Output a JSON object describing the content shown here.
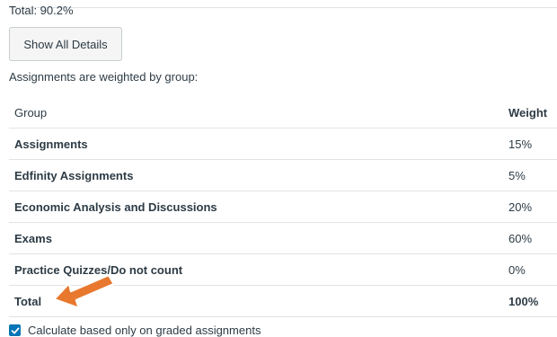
{
  "grades_summary": {
    "total_text": "Total: 90.2%",
    "show_details_label": "Show All Details",
    "weighted_caption": "Assignments are weighted by group:"
  },
  "weights_table": {
    "header_group": "Group",
    "header_weight": "Weight",
    "rows": [
      {
        "group": "Assignments",
        "weight": "15%"
      },
      {
        "group": "Edfinity Assignments",
        "weight": "5%"
      },
      {
        "group": "Economic Analysis and Discussions",
        "weight": "20%"
      },
      {
        "group": "Exams",
        "weight": "60%"
      },
      {
        "group": "Practice Quizzes/Do not count",
        "weight": "0%"
      }
    ],
    "total_label": "Total",
    "total_weight": "100%"
  },
  "options": {
    "calculate_graded_only_label": "Calculate based only on graded assignments",
    "calculate_graded_only_checked": true
  },
  "colors": {
    "accent": "#0374b5",
    "arrow": "#e8782e",
    "text": "#2d3b45",
    "rule": "#dfe3e6"
  },
  "icons": {
    "checkbox": "checkmark-icon",
    "annotation": "arrow-icon"
  }
}
